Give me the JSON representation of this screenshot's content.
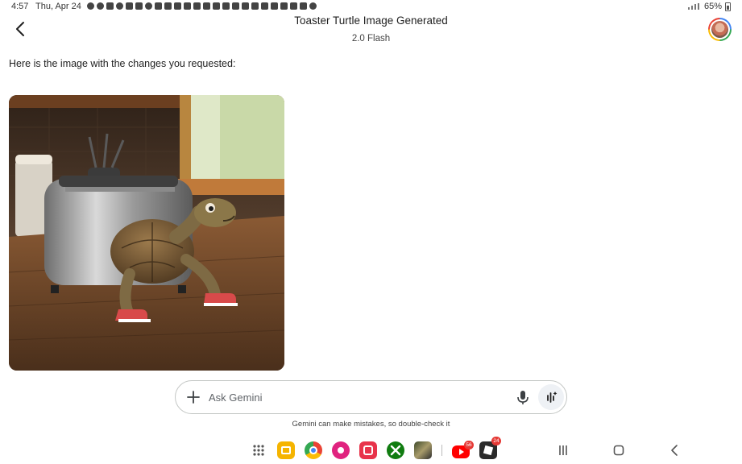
{
  "status_bar": {
    "time": "4:57",
    "date": "Thu, Apr 24",
    "battery": "65%"
  },
  "header": {
    "title": "Toaster Turtle Image Generated",
    "model": "2.0 Flash"
  },
  "conversation": {
    "response_text": "Here is the image with the changes you requested:",
    "image_icon": "generated-image-toaster-turtle"
  },
  "input": {
    "placeholder": "Ask Gemini",
    "value": ""
  },
  "disclaimer": "Gemini can make mistakes, so double-check it",
  "dock": {
    "apps": [
      {
        "name": "app-drawer-icon",
        "badge": ""
      },
      {
        "name": "my-files-icon",
        "badge": ""
      },
      {
        "name": "chrome-icon",
        "badge": ""
      },
      {
        "name": "galaxy-store-icon",
        "badge": ""
      },
      {
        "name": "camera-icon",
        "badge": ""
      },
      {
        "name": "xbox-icon",
        "badge": ""
      },
      {
        "name": "game-icon",
        "badge": ""
      },
      {
        "name": "youtube-icon",
        "badge": "56"
      },
      {
        "name": "roblox-icon",
        "badge": "24"
      }
    ]
  },
  "colors": {
    "accent": "#4285f4",
    "youtube": "#ff0000",
    "xbox": "#107c10",
    "badge": "#e53935"
  }
}
